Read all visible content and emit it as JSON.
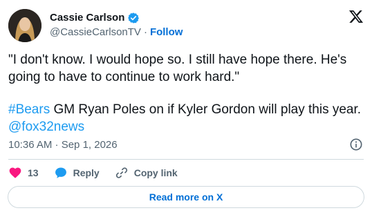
{
  "author": {
    "display_name": "Cassie Carlson",
    "handle": "@CassieCarlsonTV",
    "separator": "·",
    "follow_label": "Follow"
  },
  "tweet": {
    "quote_text": "\"I don't know. I would hope so. I still have hope there. He's going to have to continue to work hard.\"",
    "hashtag": "#Bears",
    "text_middle": " GM Ryan Poles on if Kyler Gordon will play this year. ",
    "mention": "@fox32news",
    "timestamp": "10:36 AM · Sep 1, 2026"
  },
  "actions": {
    "like_count": "13",
    "reply_label": "Reply",
    "copy_link_label": "Copy link"
  },
  "footer": {
    "read_more_label": "Read more on X"
  },
  "colors": {
    "accent_blue": "#1d9bf0",
    "link_blue": "#006fd6",
    "like_red": "#f91880",
    "muted": "#536471",
    "border": "#cfd9de"
  },
  "icons": {
    "verified": "verified-badge-icon",
    "x_logo": "x-logo-icon",
    "info": "info-icon",
    "like": "heart-icon",
    "reply": "speech-bubble-icon",
    "copy_link": "link-icon"
  }
}
